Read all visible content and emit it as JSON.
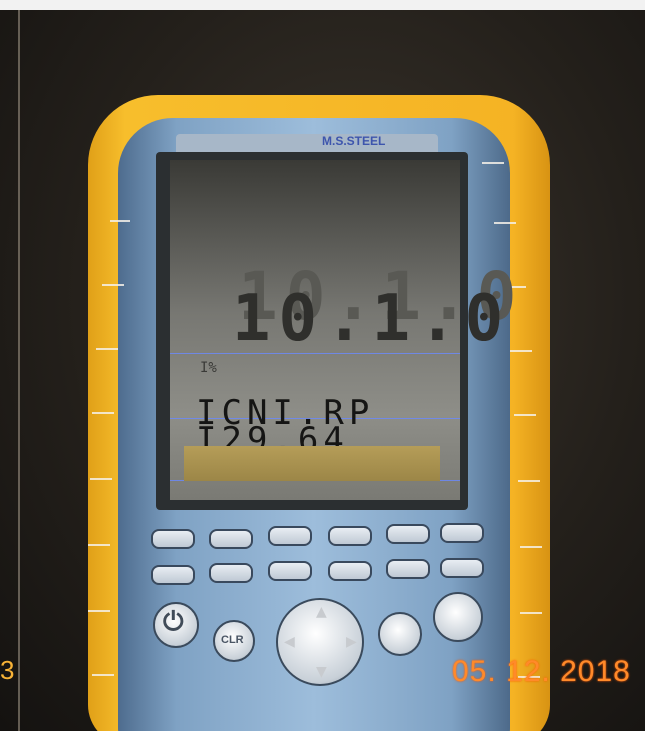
{
  "photo": {
    "timestamp": "05. 12. 2018",
    "left_edge_number": "3"
  },
  "device": {
    "brand": "M.S.STEEL",
    "display": {
      "main_value_top": "10.1.0",
      "main_value": "10.1.0",
      "small_mark": "I%",
      "label": "ICNI.RP",
      "value": "I29.64",
      "bar_level": 1.0
    },
    "keypad": {
      "clr_label": "CLR",
      "power_icon": "power-icon",
      "dpad_icon": "dpad-icon"
    },
    "colors": {
      "housing": "#f5b324",
      "body": "#8fb0cf",
      "timestamp": "#ff8a2a"
    }
  }
}
